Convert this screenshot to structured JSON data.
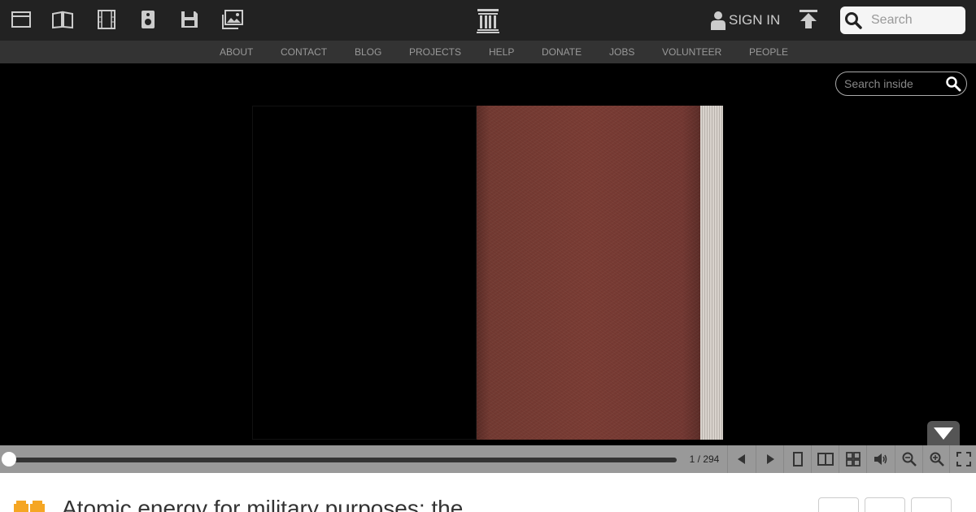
{
  "topbar": {
    "media_icons": [
      "web-icon",
      "texts-icon",
      "video-icon",
      "audio-icon",
      "software-icon",
      "images-icon"
    ],
    "logo": "archive-logo-icon",
    "signin_label": "SIGN IN",
    "search_placeholder": "Search"
  },
  "nav": {
    "links": [
      "ABOUT",
      "CONTACT",
      "BLOG",
      "PROJECTS",
      "HELP",
      "DONATE",
      "JOBS",
      "VOLUNTEER",
      "PEOPLE"
    ]
  },
  "viewer": {
    "search_inside_placeholder": "Search inside",
    "page_indicator": "1 / 294",
    "cover_color": "#7a3c34",
    "toolbar_buttons": [
      "prev-page-icon",
      "next-page-icon",
      "one-page-icon",
      "two-page-icon",
      "thumbnail-icon",
      "read-aloud-icon",
      "zoom-out-icon",
      "zoom-in-icon",
      "fullscreen-icon"
    ]
  },
  "item": {
    "title": "Atomic energy for military purposes; the"
  },
  "colors": {
    "topbar_bg": "#222222",
    "nav_bg": "#333333",
    "viewer_bg": "#000000",
    "toolbar_bg": "#999999",
    "accent_orange": "#f5a623"
  }
}
